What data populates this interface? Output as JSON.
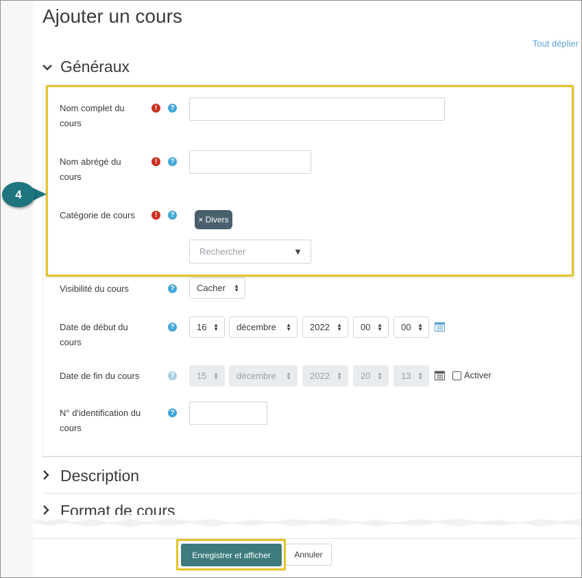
{
  "page": {
    "title": "Ajouter un cours",
    "expand_all": "Tout déplier"
  },
  "sections": {
    "general": "Généraux",
    "description": "Description",
    "format": "Format de cours"
  },
  "fields": {
    "fullname_label": "Nom complet du cours",
    "shortname_label": "Nom abrégé du cours",
    "category_label": "Catégorie de cours",
    "category_tag": "× Divers",
    "category_search_placeholder": "Rechercher",
    "visibility_label": "Visibilité du cours",
    "visibility_value": "Cacher",
    "start_label": "Date de début du cours",
    "start": {
      "day": "16",
      "month": "décembre",
      "year": "2022",
      "hour": "00",
      "minute": "00"
    },
    "end_label": "Date de fin du cours",
    "end": {
      "day": "15",
      "month": "décembre",
      "year": "2022",
      "hour": "20",
      "minute": "13"
    },
    "end_enable_label": "Activer",
    "idnumber_label": "N° d'identification du cours"
  },
  "callout": {
    "number": "4"
  },
  "buttons": {
    "save_display": "Enregistrer et afficher",
    "cancel": "Annuler"
  },
  "colors": {
    "highlight": "#e6c328",
    "callout": "#1e757f",
    "primary_button": "#3d7b7c",
    "required_icon": "#ca3120",
    "help_icon": "#43a6d7",
    "link": "#5da5d5"
  }
}
